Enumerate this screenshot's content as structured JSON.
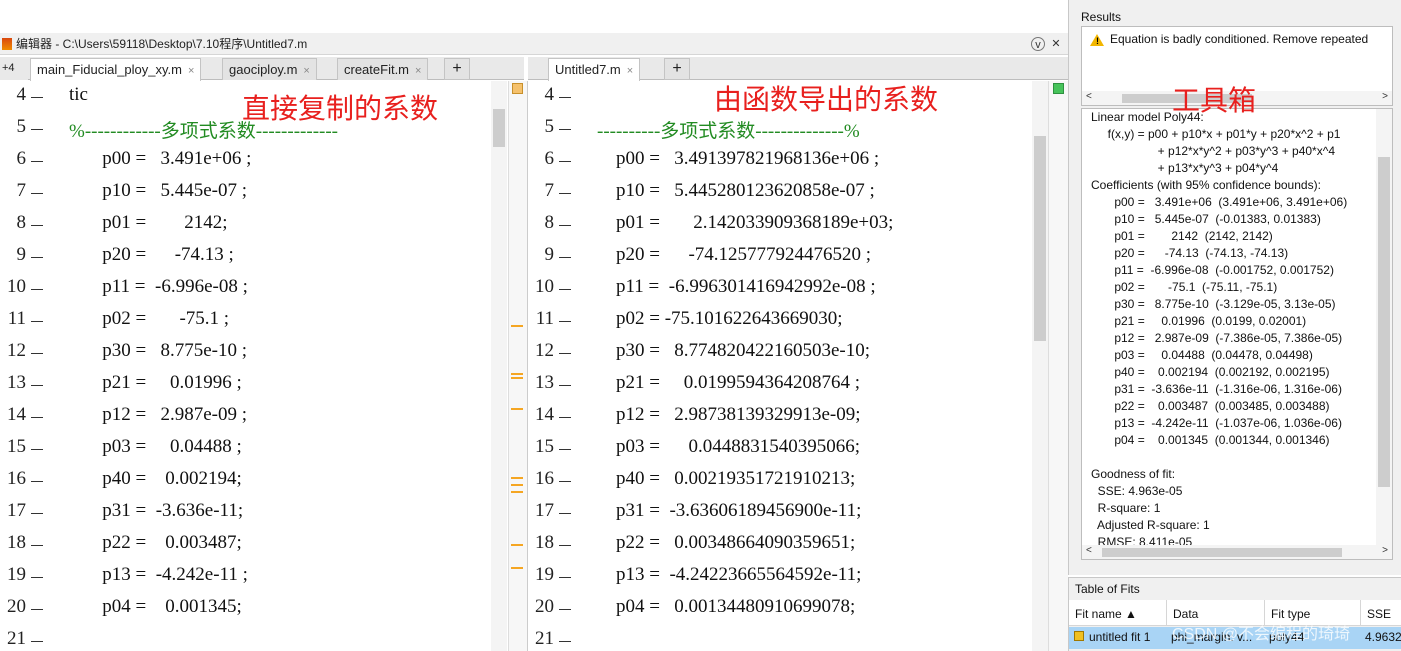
{
  "window": {
    "title": "编辑器 - C:\\Users\\59118\\Desktop\\7.10程序\\Untitled7.m",
    "menu_icon": "v-circle-icon",
    "close_icon": "x-circle-icon"
  },
  "left_tabs": {
    "overflow_label": "+4",
    "tabs": [
      {
        "label": "main_Fiducial_ploy_xy.m",
        "close": "×"
      },
      {
        "label": "gaociploy.m",
        "close": "×"
      },
      {
        "label": "createFit.m",
        "close": "×"
      }
    ],
    "plus": "+"
  },
  "right_tabs": {
    "tabs": [
      {
        "label": "Untitled7.m",
        "close": "×"
      }
    ],
    "plus": "+"
  },
  "annotations": {
    "left": "直接复制的系数",
    "middle": "由函数导出的系数",
    "right": "工具箱"
  },
  "left_editor": {
    "lines": [
      {
        "num": "4",
        "code": "    tic",
        "comment": false
      },
      {
        "num": "5",
        "code": "    %------------多项式系数-------------",
        "comment": true
      },
      {
        "num": "6",
        "code": "           p00 =   3.491e+06 ;",
        "comment": false
      },
      {
        "num": "7",
        "code": "           p10 =   5.445e-07 ;",
        "comment": false
      },
      {
        "num": "8",
        "code": "           p01 =        2142;",
        "comment": false
      },
      {
        "num": "9",
        "code": "           p20 =      -74.13 ;",
        "comment": false
      },
      {
        "num": "10",
        "code": "           p11 =  -6.996e-08 ;",
        "comment": false
      },
      {
        "num": "11",
        "code": "           p02 =       -75.1 ;",
        "comment": false
      },
      {
        "num": "12",
        "code": "           p30 =   8.775e-10 ;",
        "comment": false
      },
      {
        "num": "13",
        "code": "           p21 =     0.01996 ;",
        "comment": false
      },
      {
        "num": "14",
        "code": "           p12 =   2.987e-09 ;",
        "comment": false
      },
      {
        "num": "15",
        "code": "           p03 =     0.04488 ;",
        "comment": false
      },
      {
        "num": "16",
        "code": "           p40 =    0.002194;",
        "comment": false
      },
      {
        "num": "17",
        "code": "           p31 =  -3.636e-11;",
        "comment": false
      },
      {
        "num": "18",
        "code": "           p22 =    0.003487;",
        "comment": false
      },
      {
        "num": "19",
        "code": "           p13 =  -4.242e-11 ;",
        "comment": false
      },
      {
        "num": "20",
        "code": "           p04 =    0.001345;",
        "comment": false
      },
      {
        "num": "21",
        "code": "",
        "comment": false
      }
    ]
  },
  "right_editor": {
    "lines": [
      {
        "num": "4",
        "code": "",
        "comment": false
      },
      {
        "num": "5",
        "code": "    ----------多项式系数--------------%",
        "comment": true
      },
      {
        "num": "6",
        "code": "        p00 =   3.491397821968136e+06 ;",
        "comment": false
      },
      {
        "num": "7",
        "code": "        p10 =   5.445280123620858e-07 ;",
        "comment": false
      },
      {
        "num": "8",
        "code": "        p01 =       2.142033909368189e+03;",
        "comment": false
      },
      {
        "num": "9",
        "code": "        p20 =      -74.125777924476520 ;",
        "comment": false
      },
      {
        "num": "10",
        "code": "        p11 =  -6.996301416942992e-08 ;",
        "comment": false
      },
      {
        "num": "11",
        "code": "        p02 = -75.101622643669030;",
        "comment": false
      },
      {
        "num": "12",
        "code": "        p30 =   8.774820422160503e-10;",
        "comment": false
      },
      {
        "num": "13",
        "code": "        p21 =     0.0199594364208764 ;",
        "comment": false
      },
      {
        "num": "14",
        "code": "        p12 =   2.98738139329913e-09;",
        "comment": false
      },
      {
        "num": "15",
        "code": "        p03 =      0.0448831540395066;",
        "comment": false
      },
      {
        "num": "16",
        "code": "        p40 =   0.00219351721910213;",
        "comment": false
      },
      {
        "num": "17",
        "code": "        p31 =  -3.63606189456900e-11;",
        "comment": false
      },
      {
        "num": "18",
        "code": "        p22 =   0.00348664090359651;",
        "comment": false
      },
      {
        "num": "19",
        "code": "        p13 =  -4.24223665564592e-11;",
        "comment": false
      },
      {
        "num": "20",
        "code": "        p04 =   0.00134480910699078;",
        "comment": false
      },
      {
        "num": "21",
        "code": "",
        "comment": false
      }
    ]
  },
  "results": {
    "header": "Results",
    "warning": "Equation is badly conditioned. Remove repeated",
    "model_lines": [
      "Linear model Poly44:",
      "     f(x,y) = p00 + p10*x + p01*y + p20*x^2 + p1",
      "                    + p12*x*y^2 + p03*y^3 + p40*x^4",
      "                    + p13*x*y^3 + p04*y^4",
      "Coefficients (with 95% confidence bounds):",
      "       p00 =   3.491e+06  (3.491e+06, 3.491e+06)",
      "       p10 =   5.445e-07  (-0.01383, 0.01383)",
      "       p01 =        2142  (2142, 2142)",
      "       p20 =      -74.13  (-74.13, -74.13)",
      "       p11 =  -6.996e-08  (-0.001752, 0.001752)",
      "       p02 =       -75.1  (-75.11, -75.1)",
      "       p30 =   8.775e-10  (-3.129e-05, 3.13e-05)",
      "       p21 =     0.01996  (0.0199, 0.02001)",
      "       p12 =   2.987e-09  (-7.386e-05, 7.386e-05)",
      "       p03 =     0.04488  (0.04478, 0.04498)",
      "       p40 =    0.002194  (0.002192, 0.002195)",
      "       p31 =  -3.636e-11  (-1.316e-06, 1.316e-06)",
      "       p22 =    0.003487  (0.003485, 0.003488)",
      "       p13 =  -4.242e-11  (-1.037e-06, 1.036e-06)",
      "       p04 =    0.001345  (0.001344, 0.001346)",
      "",
      "Goodness of fit:",
      "  SSE: 4.963e-05",
      "  R-square: 1",
      "  Adjusted R-square: 1",
      "  RMSE: 8.411e-05"
    ]
  },
  "table_of_fits": {
    "header": "Table of Fits",
    "columns": [
      "Fit name ▲",
      "Data",
      "Fit type",
      "SSE"
    ],
    "row": [
      "untitled fit 1",
      "phi_margin: v...",
      "poly44",
      "4.9632"
    ]
  },
  "watermark": "CSDN @不会编程的琦琦"
}
